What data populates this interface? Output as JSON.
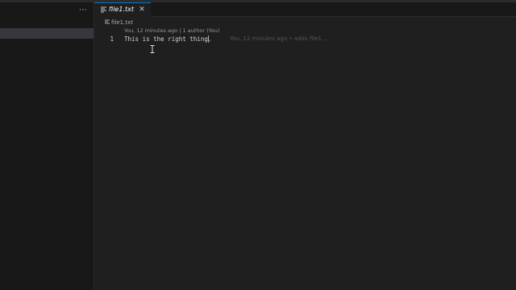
{
  "sidebar": {
    "more_label": "···"
  },
  "tabs": [
    {
      "label": "file1.txt",
      "close_glyph": "✕",
      "active": true
    }
  ],
  "breadcrumb": {
    "file": "file1.txt"
  },
  "editor": {
    "codelens": "You, 12 minutes ago | 1 author (You)",
    "lines": [
      {
        "number": "1",
        "text": "This is the right thing.",
        "blame": "You, 12 minutes ago • adds file1 …"
      }
    ]
  },
  "icons": {
    "tab_file": "file-lines-icon",
    "breadcrumb_file": "file-lines-icon",
    "pointer": "text-cursor-icon"
  },
  "colors": {
    "accent": "#0078d4",
    "editor_bg": "#1f1f1f",
    "sidebar_bg": "#181818",
    "selection_bg": "#37373d"
  }
}
